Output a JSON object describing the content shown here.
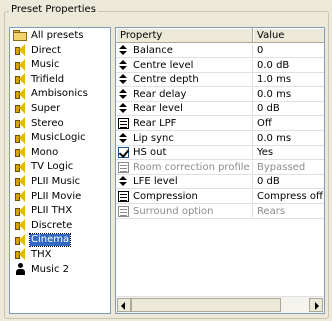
{
  "group_title": "Preset Properties",
  "tree": {
    "root": "All presets",
    "items": [
      {
        "label": "Direct",
        "icon": "speaker-icon"
      },
      {
        "label": "Music",
        "icon": "speaker-icon"
      },
      {
        "label": "Trifield",
        "icon": "speaker-icon"
      },
      {
        "label": "Ambisonics",
        "icon": "speaker-icon"
      },
      {
        "label": "Super",
        "icon": "speaker-icon"
      },
      {
        "label": "Stereo",
        "icon": "speaker-icon"
      },
      {
        "label": "MusicLogic",
        "icon": "speaker-icon"
      },
      {
        "label": "Mono",
        "icon": "speaker-icon"
      },
      {
        "label": "TV Logic",
        "icon": "speaker-icon"
      },
      {
        "label": "PLII Music",
        "icon": "speaker-icon"
      },
      {
        "label": "PLII Movie",
        "icon": "speaker-icon"
      },
      {
        "label": "PLII THX",
        "icon": "speaker-icon"
      },
      {
        "label": "Discrete",
        "icon": "speaker-icon"
      },
      {
        "label": "Cinema",
        "icon": "speaker-icon",
        "selected": true
      },
      {
        "label": "THX",
        "icon": "speaker-icon"
      },
      {
        "label": "Music 2",
        "icon": "user-icon"
      }
    ]
  },
  "grid": {
    "col_property": "Property",
    "col_value": "Value",
    "rows": [
      {
        "property": "Balance",
        "value": "0",
        "icon": "updown",
        "disabled": false
      },
      {
        "property": "Centre level",
        "value": "0.0 dB",
        "icon": "updown",
        "disabled": false
      },
      {
        "property": "Centre depth",
        "value": "1.0 ms",
        "icon": "updown",
        "disabled": false
      },
      {
        "property": "Rear delay",
        "value": "0.0 ms",
        "icon": "updown",
        "disabled": false
      },
      {
        "property": "Rear level",
        "value": "0 dB",
        "icon": "updown",
        "disabled": false
      },
      {
        "property": "Rear LPF",
        "value": "Off",
        "icon": "list",
        "disabled": false
      },
      {
        "property": "Lip sync",
        "value": "0.0 ms",
        "icon": "updown",
        "disabled": false
      },
      {
        "property": "HS out",
        "value": "Yes",
        "icon": "check",
        "disabled": false
      },
      {
        "property": "Room correction profile",
        "value": "Bypassed",
        "icon": "list",
        "disabled": true
      },
      {
        "property": "LFE level",
        "value": "0 dB",
        "icon": "updown",
        "disabled": false
      },
      {
        "property": "Compression",
        "value": "Compress off",
        "icon": "list",
        "disabled": false
      },
      {
        "property": "Surround option",
        "value": "Rears",
        "icon": "list",
        "disabled": true
      }
    ]
  }
}
